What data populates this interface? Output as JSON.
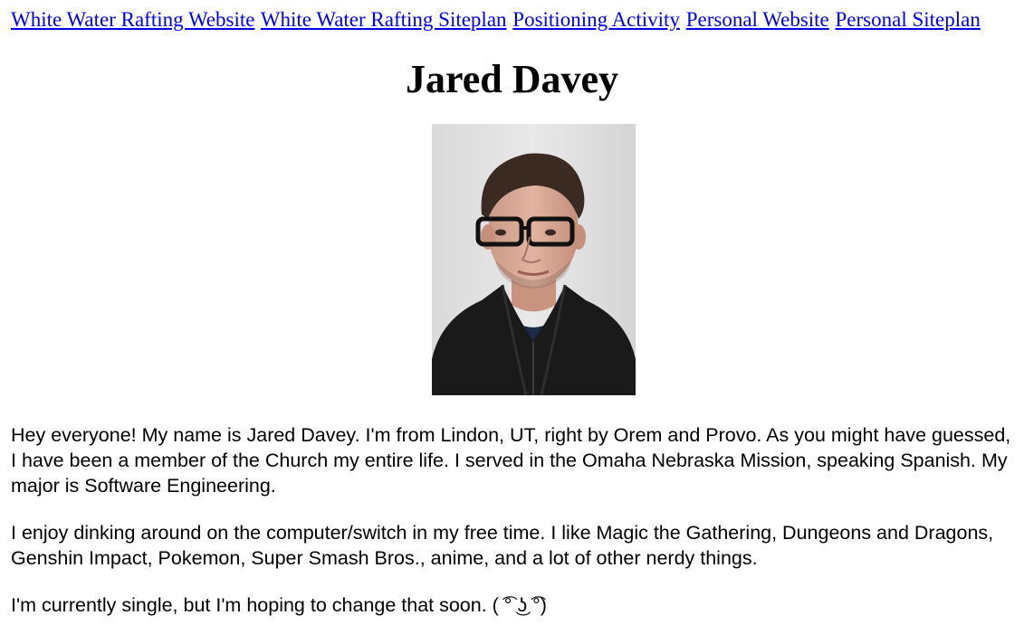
{
  "nav": {
    "links": [
      "White Water Rafting Website",
      "White Water Rafting Siteplan",
      "Positioning Activity",
      "Personal Website",
      "Personal Siteplan"
    ]
  },
  "header": {
    "title": "Jared Davey"
  },
  "main": {
    "paragraphs": [
      "Hey everyone! My name is Jared Davey. I'm from Lindon, UT, right by Orem and Provo. As you might have guessed, I have been a member of the Church my entire life. I served in the Omaha Nebraska Mission, speaking Spanish. My major is Software Engineering.",
      "I enjoy dinking around on the computer/switch in my free time. I like Magic the Gathering, Dungeons and Dragons, Genshin Impact, Pokemon, Super Smash Bros., anime, and a lot of other nerdy things.",
      "I'm currently single, but I'm hoping to change that soon. ( ͡° ͜ʖ ͡°)"
    ]
  },
  "colors": {
    "link": "#0000ee",
    "text": "#000000",
    "background": "#ffffff"
  }
}
